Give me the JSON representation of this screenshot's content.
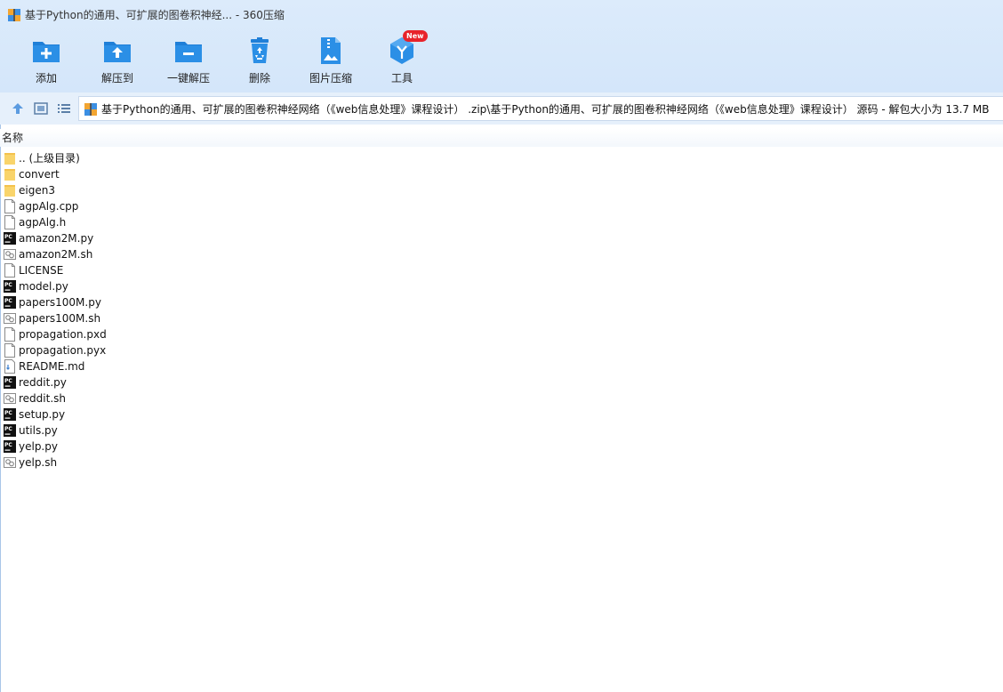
{
  "window": {
    "title": "基于Python的通用、可扩展的图卷积神经... - 360压缩",
    "colors": {
      "accent": "#2b8fe6",
      "toolbar_bg": "#d8e8fa",
      "folder": "#f9d46b",
      "badge": "#e8232b"
    }
  },
  "toolbar": {
    "items": [
      {
        "label": "添加",
        "icon": "add-folder-icon"
      },
      {
        "label": "解压到",
        "icon": "extract-to-folder-icon"
      },
      {
        "label": "一键解压",
        "icon": "one-click-extract-icon"
      },
      {
        "label": "删除",
        "icon": "recycle-bin-icon"
      },
      {
        "label": "图片压缩",
        "icon": "image-compress-icon"
      },
      {
        "label": "工具",
        "icon": "tools-cube-icon",
        "badge": "New"
      }
    ]
  },
  "address": {
    "path": "基于Python的通用、可扩展的图卷积神经网络（《web信息处理》课程设计） .zip\\基于Python的通用、可扩展的图卷积神经网络（《web信息处理》课程设计） 源码 - 解包大小为 13.7 MB",
    "icons": [
      "up-arrow-icon",
      "thumbnail-view-icon",
      "list-view-icon",
      "archive-icon"
    ]
  },
  "list": {
    "column_name": "名称",
    "files": [
      {
        "name": ".. (上级目录)",
        "type": "folder"
      },
      {
        "name": "convert",
        "type": "folder"
      },
      {
        "name": "eigen3",
        "type": "folder"
      },
      {
        "name": "agpAlg.cpp",
        "type": "file"
      },
      {
        "name": "agpAlg.h",
        "type": "file"
      },
      {
        "name": "amazon2M.py",
        "type": "pycharm"
      },
      {
        "name": "amazon2M.sh",
        "type": "shell"
      },
      {
        "name": "LICENSE",
        "type": "file"
      },
      {
        "name": "model.py",
        "type": "pycharm"
      },
      {
        "name": "papers100M.py",
        "type": "pycharm"
      },
      {
        "name": "papers100M.sh",
        "type": "shell"
      },
      {
        "name": "propagation.pxd",
        "type": "file"
      },
      {
        "name": "propagation.pyx",
        "type": "file"
      },
      {
        "name": "README.md",
        "type": "markdown"
      },
      {
        "name": "reddit.py",
        "type": "pycharm"
      },
      {
        "name": "reddit.sh",
        "type": "shell"
      },
      {
        "name": "setup.py",
        "type": "pycharm"
      },
      {
        "name": "utils.py",
        "type": "pycharm"
      },
      {
        "name": "yelp.py",
        "type": "pycharm"
      },
      {
        "name": "yelp.sh",
        "type": "shell"
      }
    ]
  }
}
